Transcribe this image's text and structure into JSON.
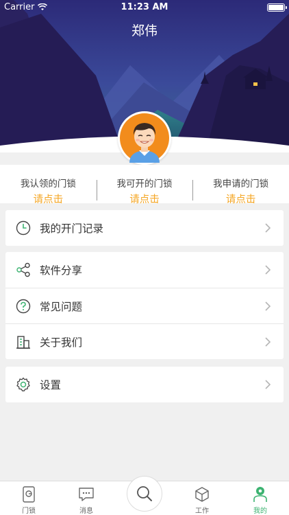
{
  "status_bar": {
    "carrier": "Carrier",
    "time": "11:23 AM"
  },
  "profile": {
    "name": "郑伟"
  },
  "stats": [
    {
      "label": "我认领的门锁",
      "action": "请点击"
    },
    {
      "label": "我可开的门锁",
      "action": "请点击"
    },
    {
      "label": "我申请的门锁",
      "action": "请点击"
    }
  ],
  "menu": {
    "records": {
      "label": "我的开门记录",
      "icon": "clock-icon"
    },
    "share": {
      "label": "软件分享",
      "icon": "share-icon"
    },
    "faq": {
      "label": "常见问题",
      "icon": "question-icon"
    },
    "about": {
      "label": "关于我们",
      "icon": "building-icon"
    },
    "settings": {
      "label": "设置",
      "icon": "gear-icon"
    }
  },
  "tabbar": {
    "tabs": [
      {
        "label": "门锁",
        "icon": "door-lock-icon"
      },
      {
        "label": "消息",
        "icon": "message-icon"
      },
      {
        "label": "工作",
        "icon": "box-icon"
      },
      {
        "label": "我的",
        "icon": "person-icon",
        "active": true
      }
    ],
    "center_icon": "search-icon"
  },
  "colors": {
    "accent": "#3cb371",
    "action": "#f5a623",
    "header_top": "#2b2f7a",
    "header_bottom": "#3a5d86"
  }
}
